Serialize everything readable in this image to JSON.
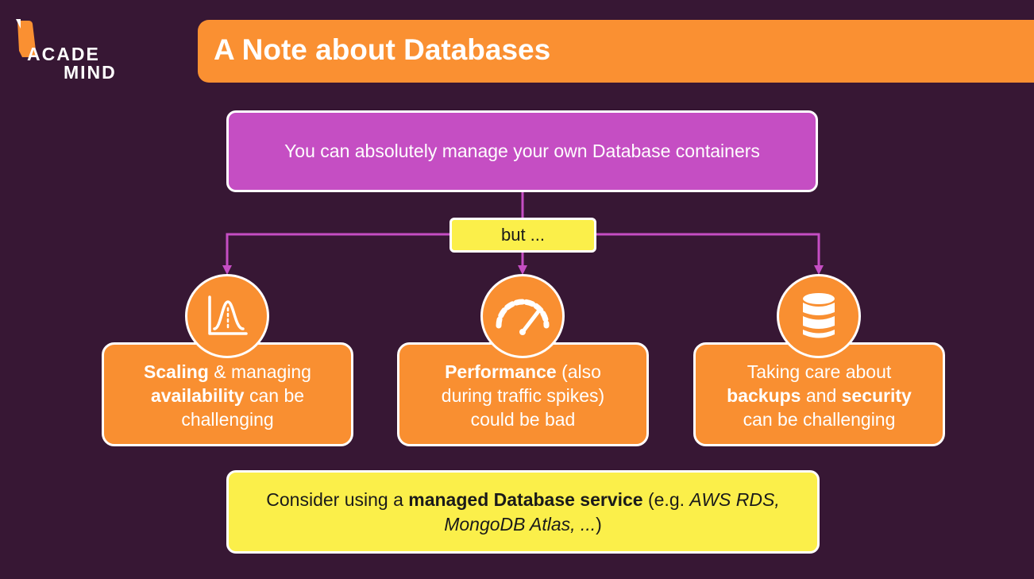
{
  "logo": {
    "line1": "ACADE",
    "line2": "MIND"
  },
  "title": "A Note about Databases",
  "intro": "You can absolutely manage your own Database containers",
  "connector": "but ...",
  "cards": [
    {
      "icon": "bell-curve-chart-icon",
      "bold1": "Scaling",
      "text1": " & managing",
      "bold2": "availability",
      "text2": " can be",
      "text3": "challenging"
    },
    {
      "icon": "speedometer-icon",
      "bold1": "Performance",
      "text1": " (also",
      "text2": "during traffic spikes)",
      "text3": "could be bad"
    },
    {
      "icon": "database-icon",
      "text1": "Taking care about",
      "bold2": "backups",
      "text2": " and ",
      "bold3": "security",
      "text3": "can be challenging"
    }
  ],
  "recommendation": {
    "pre": "Consider using a ",
    "bold": "managed Database service",
    "mid": " (e.g. ",
    "examples": "AWS RDS, MongoDB Atlas, ...",
    "post": ")"
  },
  "colors": {
    "background": "#371734",
    "orange": "#fa9032",
    "magenta": "#c54ec3",
    "yellow": "#fbef4a"
  }
}
